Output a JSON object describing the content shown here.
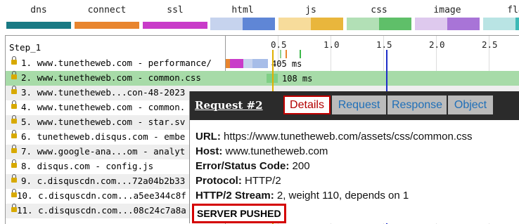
{
  "legend": [
    {
      "label": "dns",
      "color_a": "#1a7a84",
      "color_b": "#1a7a84"
    },
    {
      "label": "connect",
      "color_a": "#e8852e",
      "color_b": "#e8852e"
    },
    {
      "label": "ssl",
      "color_a": "#c93bc9",
      "color_b": "#c93bc9"
    },
    {
      "label": "html",
      "color_a": "#c6d3ee",
      "color_b": "#5f86d6"
    },
    {
      "label": "js",
      "color_a": "#f7dc9b",
      "color_b": "#e9b63c"
    },
    {
      "label": "css",
      "color_a": "#b2e0b6",
      "color_b": "#5fbf69"
    },
    {
      "label": "image",
      "color_a": "#dec9ee",
      "color_b": "#a874d7"
    },
    {
      "label": "fla",
      "color_a": "#b9e4e4",
      "color_b": "#3cb9b6"
    }
  ],
  "waterfall": {
    "step_label": "Step_1",
    "ticks": [
      "0.5",
      "1.0",
      "1.5",
      "2.0",
      "2.5"
    ],
    "rows": [
      {
        "text": "1. www.tunetheweb.com - performance/",
        "duration": "405 ms"
      },
      {
        "text": "2. www.tunetheweb.com - common.css",
        "duration": "108 ms",
        "selected": true
      },
      {
        "text": "3. www.tunetheweb...con-48-2023"
      },
      {
        "text": "4. www.tunetheweb.com - common."
      },
      {
        "text": "5. www.tunetheweb.com - star.sv"
      },
      {
        "text": "6. tunetheweb.disqus.com - embe"
      },
      {
        "text": "7. www.google-ana...om - analyt"
      },
      {
        "text": "8. disqus.com - config.js"
      },
      {
        "text": "9. c.disquscdn.com...72a04b2b33"
      },
      {
        "text": "10. c.disquscdn.com...a5ee344c8f"
      },
      {
        "text": "11. c.disquscdn.com...08c24c7a8a"
      }
    ]
  },
  "popup": {
    "title": "Request #2",
    "tabs": [
      "Details",
      "Request",
      "Response",
      "Object"
    ],
    "active_tab": "Details",
    "fields": [
      {
        "key": "URL:",
        "value": " https://www.tunetheweb.com/assets/css/common.css"
      },
      {
        "key": "Host:",
        "value": " www.tunetheweb.com"
      },
      {
        "key": "Error/Status Code:",
        "value": " 200"
      },
      {
        "key": "Protocol:",
        "value": " HTTP/2"
      },
      {
        "key": "HTTP/2 Stream:",
        "value": " 2, weight 110, depends on 1"
      }
    ],
    "flag": "SERVER PUSHED"
  }
}
